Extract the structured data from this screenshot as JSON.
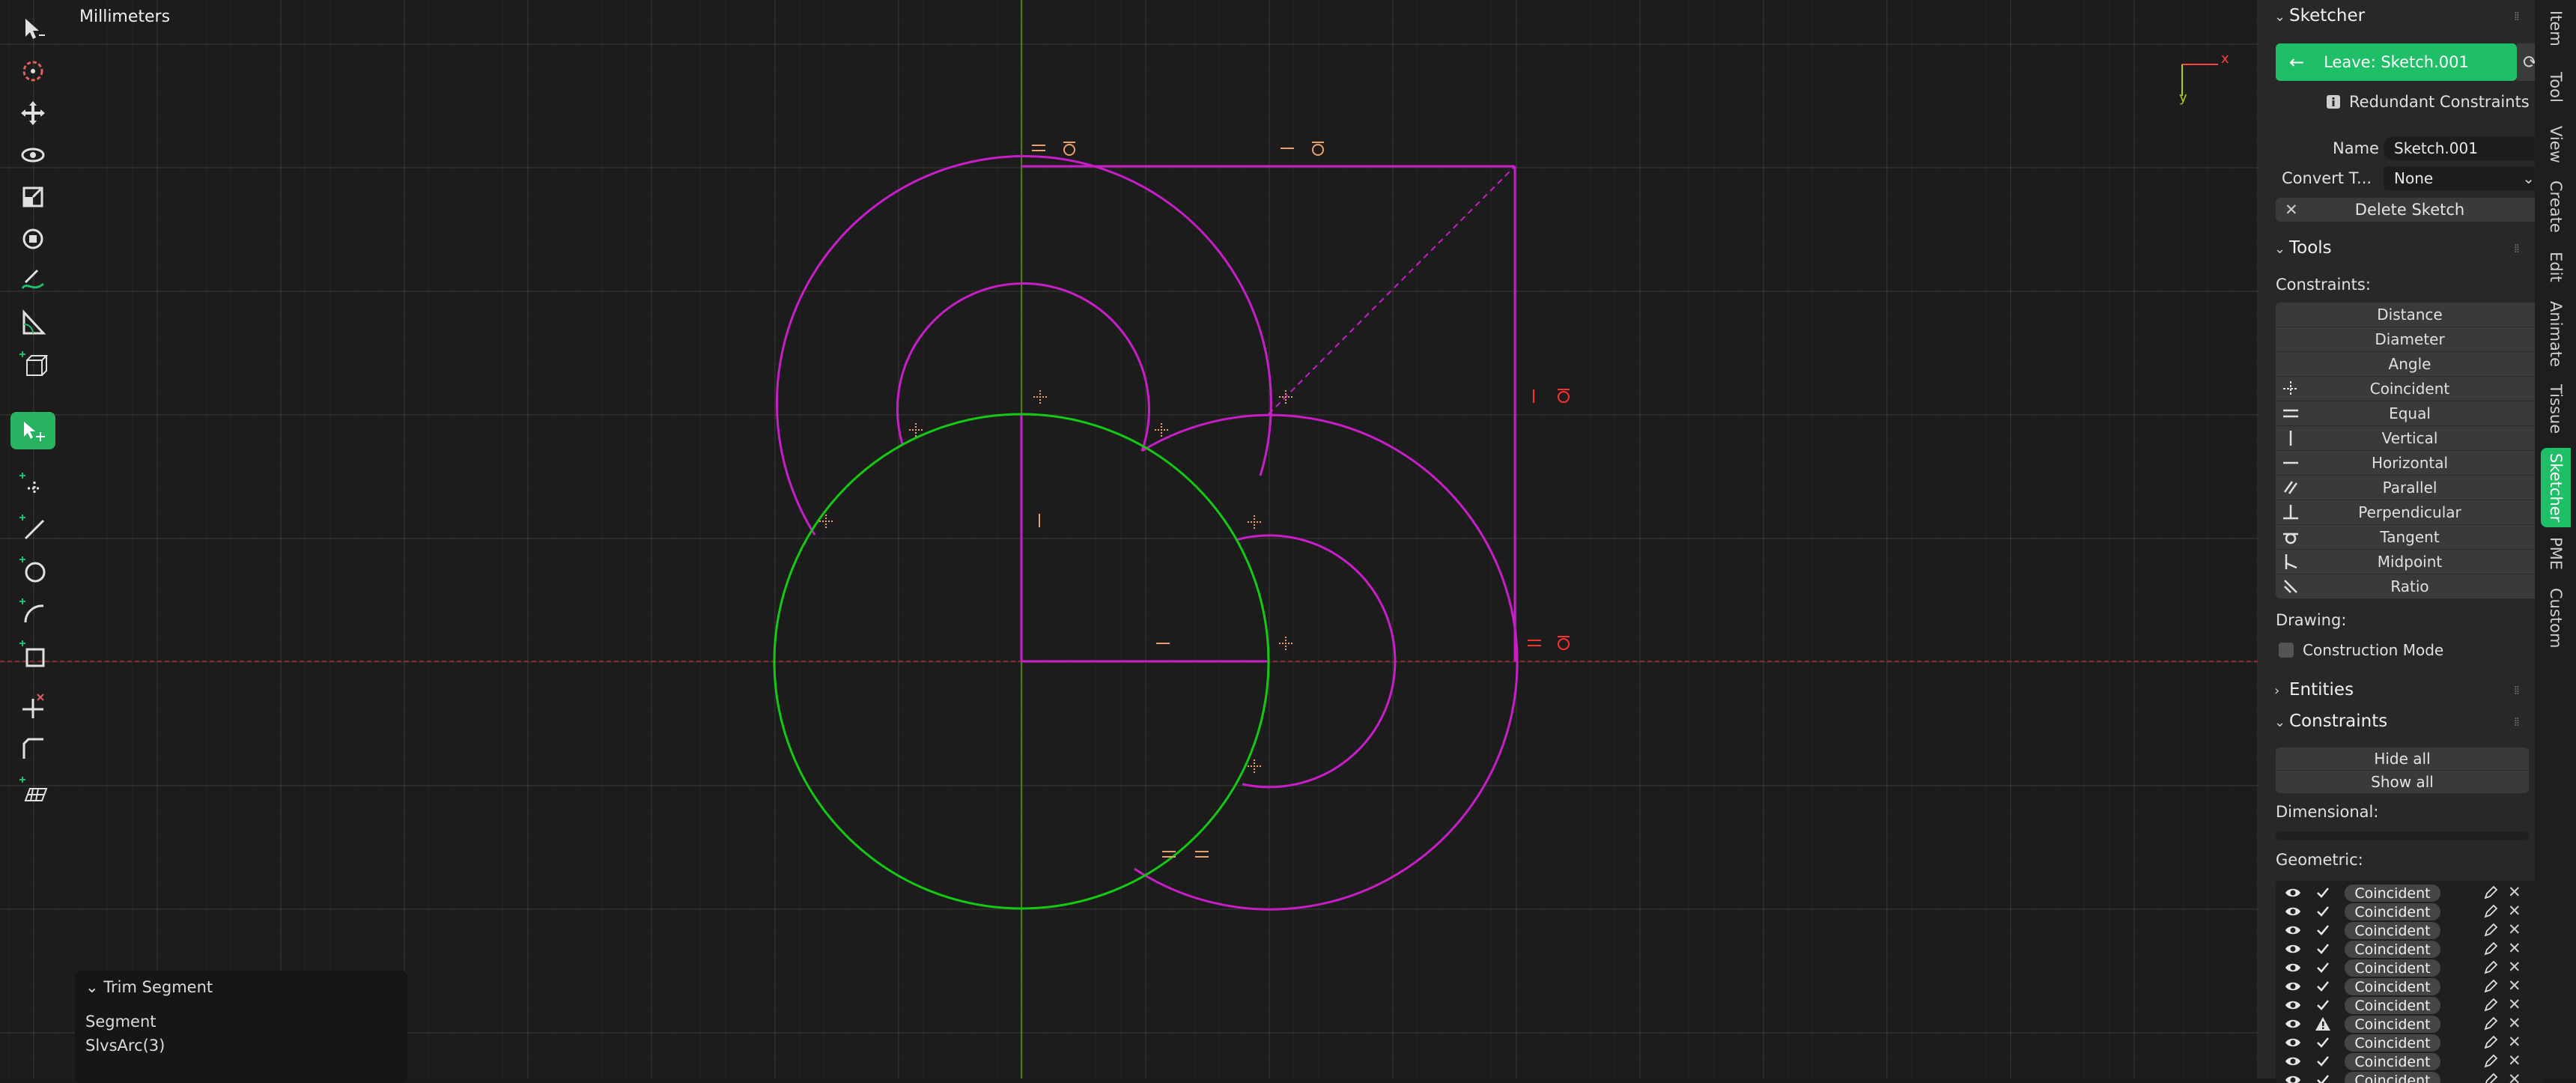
{
  "viewport": {
    "units_label": "Millimeters",
    "axis_x_label": "x",
    "axis_y_label": "y",
    "colors": {
      "grid_bg": "#1c1c1c",
      "sketch_curve": "#c81ec8",
      "selected_curve": "#14c814",
      "x_axis": "#8a2a2a",
      "y_axis": "#4a7a1a",
      "constraint_icon_ok": "#e8a070",
      "constraint_icon_error": "#ff3030"
    }
  },
  "toolbar": {
    "tools": [
      {
        "name": "select-tool"
      },
      {
        "name": "cursor-tool"
      },
      {
        "name": "move-tool"
      },
      {
        "name": "rotate-tool"
      },
      {
        "name": "scale-tool"
      },
      {
        "name": "transform-tool"
      },
      {
        "name": "annotate-tool"
      },
      {
        "name": "measure-tool"
      },
      {
        "name": "add-cube-tool"
      },
      {
        "name": "sketcher-select-tool",
        "active": true
      },
      {
        "name": "add-point-tool"
      },
      {
        "name": "add-line-tool"
      },
      {
        "name": "add-circle-tool"
      },
      {
        "name": "add-arc-tool"
      },
      {
        "name": "add-rectangle-tool"
      },
      {
        "name": "trim-tool"
      },
      {
        "name": "bevel-tool"
      },
      {
        "name": "add-workplane-tool"
      }
    ]
  },
  "redo_panel": {
    "title": "Trim Segment",
    "field_label": "Segment",
    "field_value": "SlvsArc(3)"
  },
  "sidebar": {
    "sketcher": {
      "title": "Sketcher",
      "leave_label": "Leave: Sketch.001",
      "warning_text": "Redundant Constraints",
      "name_label": "Name",
      "name_value": "Sketch.001",
      "convert_label": "Convert T...",
      "convert_value": "None",
      "delete_label": "Delete Sketch"
    },
    "tools": {
      "title": "Tools",
      "constraints_label": "Constraints:",
      "constraints": [
        {
          "label": "Distance",
          "icon": "none"
        },
        {
          "label": "Diameter",
          "icon": "none"
        },
        {
          "label": "Angle",
          "icon": "none"
        },
        {
          "label": "Coincident",
          "icon": "coincident-icon"
        },
        {
          "label": "Equal",
          "icon": "equal-icon"
        },
        {
          "label": "Vertical",
          "icon": "vertical-icon"
        },
        {
          "label": "Horizontal",
          "icon": "horizontal-icon"
        },
        {
          "label": "Parallel",
          "icon": "parallel-icon"
        },
        {
          "label": "Perpendicular",
          "icon": "perpendicular-icon"
        },
        {
          "label": "Tangent",
          "icon": "tangent-icon"
        },
        {
          "label": "Midpoint",
          "icon": "midpoint-icon"
        },
        {
          "label": "Ratio",
          "icon": "ratio-icon"
        }
      ],
      "drawing_label": "Drawing:",
      "construction_label": "Construction Mode"
    },
    "entities": {
      "title": "Entities"
    },
    "constraints_panel": {
      "title": "Constraints",
      "hide_all": "Hide all",
      "show_all": "Show all",
      "dimensional_label": "Dimensional:",
      "geometric_label": "Geometric:",
      "geometric_rows": [
        {
          "name": "Coincident",
          "status": "ok"
        },
        {
          "name": "Coincident",
          "status": "ok"
        },
        {
          "name": "Coincident",
          "status": "ok"
        },
        {
          "name": "Coincident",
          "status": "ok"
        },
        {
          "name": "Coincident",
          "status": "ok"
        },
        {
          "name": "Coincident",
          "status": "ok"
        },
        {
          "name": "Coincident",
          "status": "ok"
        },
        {
          "name": "Coincident",
          "status": "warning"
        },
        {
          "name": "Coincident",
          "status": "ok"
        },
        {
          "name": "Coincident",
          "status": "ok"
        },
        {
          "name": "Coincident",
          "status": "ok"
        }
      ]
    }
  },
  "vertical_tabs": [
    {
      "label": "Item"
    },
    {
      "label": "Tool"
    },
    {
      "label": "View"
    },
    {
      "label": "Create"
    },
    {
      "label": "Edit"
    },
    {
      "label": "Animate"
    },
    {
      "label": "Tissue"
    },
    {
      "label": "Sketcher",
      "active": true
    },
    {
      "label": "PME"
    },
    {
      "label": "Custom"
    }
  ]
}
